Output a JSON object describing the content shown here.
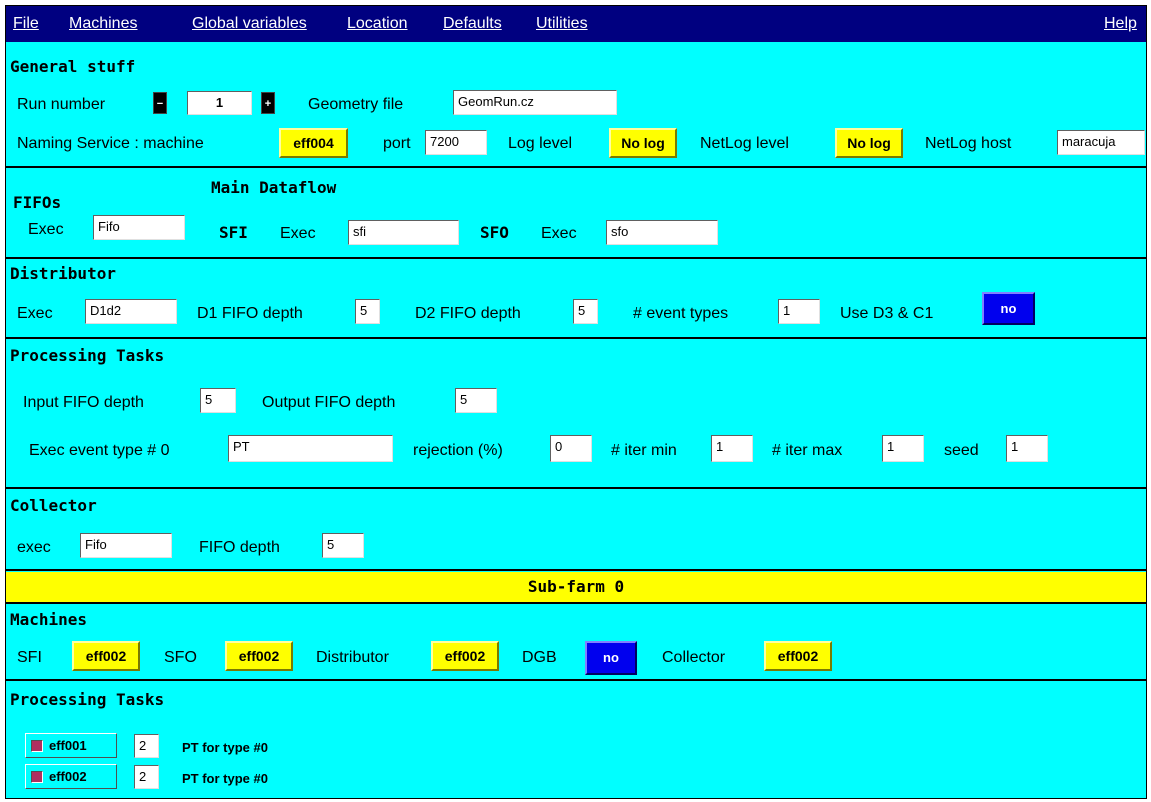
{
  "menubar": {
    "file": "File",
    "machines": "Machines",
    "global_variables": "Global variables",
    "location": "Location",
    "defaults": "Defaults",
    "utilities": "Utilities",
    "help": "Help"
  },
  "general": {
    "title": "General stuff",
    "run_number_label": "Run number",
    "run_number": "1",
    "geometry_file_label": "Geometry file",
    "geometry_file": "GeomRun.cz",
    "naming_service_label": "Naming Service : machine",
    "naming_machine": "eff004",
    "port_label": "port",
    "port": "7200",
    "log_level_label": "Log level",
    "log_level": "No log",
    "netlog_level_label": "NetLog level",
    "netlog_level": "No log",
    "netlog_host_label": "NetLog host",
    "netlog_host": "maracuja"
  },
  "fifos": {
    "title": "FIFOs",
    "exec_label": "Exec",
    "exec": "Fifo"
  },
  "main_dataflow": {
    "title": "Main Dataflow",
    "sfi_label": "SFI",
    "sfi_exec_label": "Exec",
    "sfi_exec": "sfi",
    "sfo_label": "SFO",
    "sfo_exec_label": "Exec",
    "sfo_exec": "sfo"
  },
  "distributor": {
    "title": "Distributor",
    "exec_label": "Exec",
    "exec": "D1d2",
    "d1_label": "D1 FIFO depth",
    "d1": "5",
    "d2_label": "D2 FIFO depth",
    "d2": "5",
    "event_types_label": "# event types",
    "event_types": "1",
    "use_d3_label": "Use D3 & C1",
    "use_d3": "no"
  },
  "processing": {
    "title": "Processing Tasks",
    "input_depth_label": "Input FIFO depth",
    "input_depth": "5",
    "output_depth_label": "Output FIFO depth",
    "output_depth": "5",
    "exec_type_label": "Exec event type # 0",
    "exec_type": "PT",
    "rejection_label": "rejection (%)",
    "rejection": "0",
    "iter_min_label": "# iter min",
    "iter_min": "1",
    "iter_max_label": "# iter max",
    "iter_max": "1",
    "seed_label": "seed",
    "seed": "1"
  },
  "collector": {
    "title": "Collector",
    "exec_label": "exec",
    "exec": "Fifo",
    "depth_label": "FIFO depth",
    "depth": "5"
  },
  "subfarm": {
    "title": "Sub-farm 0"
  },
  "machines": {
    "title": "Machines",
    "sfi_label": "SFI",
    "sfi": "eff002",
    "sfo_label": "SFO",
    "sfo": "eff002",
    "distributor_label": "Distributor",
    "distributor": "eff002",
    "dgb_label": "DGB",
    "dgb": "no",
    "collector_label": "Collector",
    "collector": "eff002"
  },
  "subfarm_tasks": {
    "title": "Processing Tasks",
    "rows": [
      {
        "machine": "eff001",
        "count": "2",
        "desc": "PT for type #0"
      },
      {
        "machine": "eff002",
        "count": "2",
        "desc": "PT for type #0"
      }
    ]
  },
  "colors": {
    "background": "#00ffff",
    "menubar": "#000080",
    "button_yellow": "#ffff00",
    "button_blue": "#0000ee",
    "checkbox_indicator": "#b03060"
  }
}
